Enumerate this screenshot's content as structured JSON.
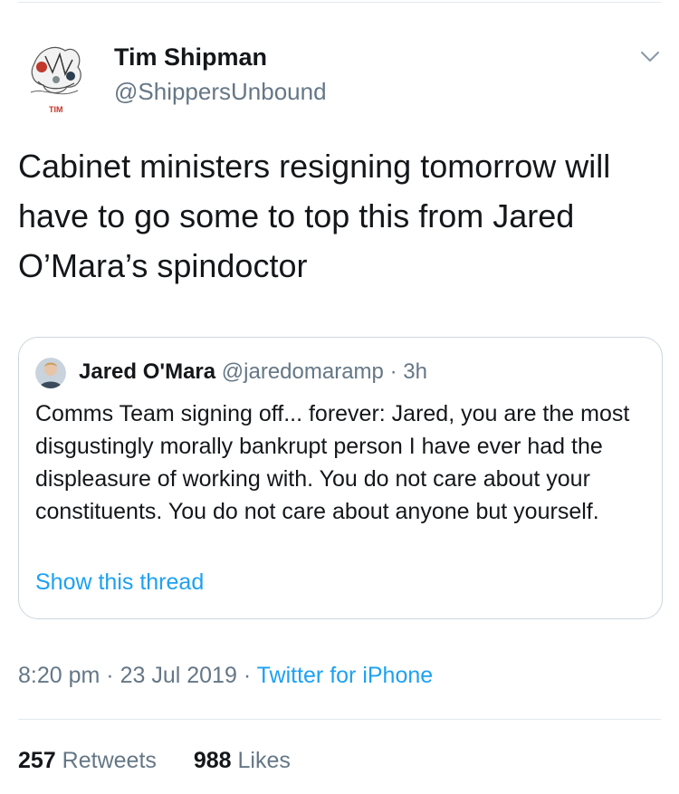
{
  "tweet": {
    "author_name": "Tim Shipman",
    "author_handle": "@ShippersUnbound",
    "avatar_caption": "TIM",
    "text": "Cabinet ministers resigning tomorrow will have to go some to top this from Jared O’Mara’s spindoctor",
    "time": "8:20 pm",
    "date": "23 Jul 2019",
    "source": "Twitter for iPhone",
    "sep": "·"
  },
  "quoted": {
    "author_name": "Jared O'Mara",
    "author_handle": "@jaredomaramp",
    "age": "3h",
    "sep": "·",
    "text": "Comms Team signing off... forever: Jared, you are the most disgustingly morally bankrupt person I have ever had the displeasure of working with. You do not care about your constituents. You do not care about anyone but yourself.",
    "show_thread": "Show this thread"
  },
  "stats": {
    "retweets_count": "257",
    "retweets_label": "Retweets",
    "likes_count": "988",
    "likes_label": "Likes"
  },
  "icons": {
    "menu": "chevron-down-icon"
  },
  "colors": {
    "link": "#1da1f2",
    "secondary": "#657786",
    "text": "#14171a",
    "border": "#ccd6dd"
  }
}
